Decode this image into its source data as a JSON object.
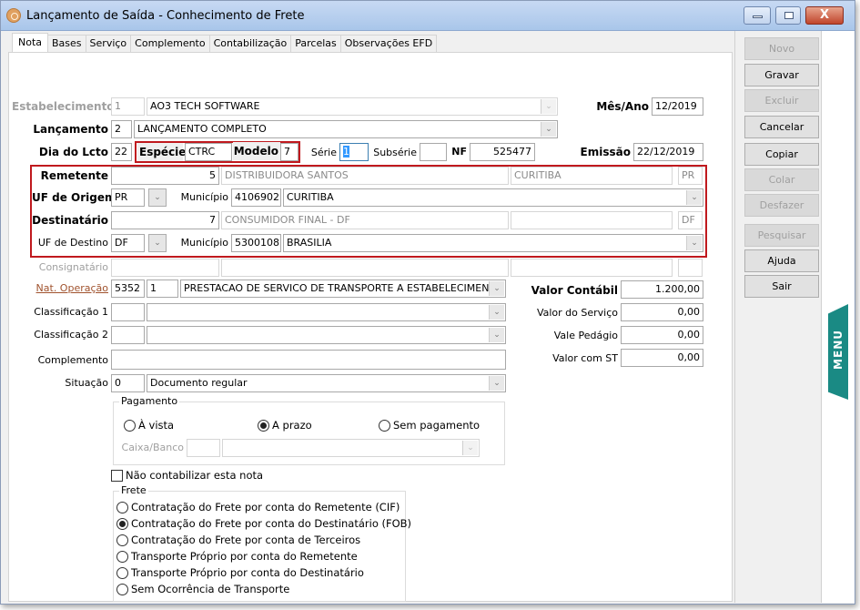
{
  "window": {
    "title": "Lançamento de Saída - Conhecimento de Frete",
    "minimize_label": "",
    "maximize_label": "",
    "close_label": "X"
  },
  "tabs": [
    {
      "label": "Nota",
      "active": true
    },
    {
      "label": "Bases"
    },
    {
      "label": "Serviço"
    },
    {
      "label": "Complemento"
    },
    {
      "label": "Contabilização"
    },
    {
      "label": "Parcelas"
    },
    {
      "label": "Observações EFD"
    }
  ],
  "form": {
    "estabelecimento": {
      "label": "Estabelecimento",
      "code": "1",
      "name": "AO3 TECH SOFTWARE"
    },
    "mes_ano": {
      "label": "Mês/Ano",
      "value": "12/2019"
    },
    "lancamento": {
      "label": "Lançamento",
      "code": "2",
      "name": "LANÇAMENTO COMPLETO"
    },
    "dia_lcto": {
      "label": "Dia do Lcto",
      "value": "22"
    },
    "especie": {
      "label": "Espécie",
      "value": "CTRC"
    },
    "modelo": {
      "label": "Modelo",
      "value": "7"
    },
    "serie": {
      "label": "Série",
      "value": "1"
    },
    "subserie": {
      "label": "Subsérie",
      "value": ""
    },
    "nf": {
      "label": "NF",
      "value": "525477"
    },
    "emissao": {
      "label": "Emissão",
      "value": "22/12/2019"
    },
    "remetente": {
      "label": "Remetente",
      "code": "5",
      "name": "DISTRIBUIDORA SANTOS",
      "city": "CURITIBA",
      "uf": "PR"
    },
    "uf_origem": {
      "label": "UF de Origem",
      "value": "PR",
      "municipio_label": "Município",
      "municipio_code": "4106902",
      "municipio_name": "CURITIBA"
    },
    "destinatario": {
      "label": "Destinatário",
      "code": "7",
      "name": "CONSUMIDOR FINAL - DF",
      "city": "",
      "uf": "DF"
    },
    "uf_destino": {
      "label": "UF de Destino",
      "value": "DF",
      "municipio_label": "Município",
      "municipio_code": "5300108",
      "municipio_name": "BRASILIA"
    },
    "consignatario": {
      "label": "Consignatário",
      "code": "",
      "name": "",
      "city": "",
      "uf": ""
    },
    "nat_operacao": {
      "label": "Nat. Operação",
      "code": "5352",
      "seq": "1",
      "description": "PRESTACAO DE SERVICO DE TRANSPORTE A ESTABELECIMEN"
    },
    "classificacao1": {
      "label": "Classificação 1",
      "code": "",
      "value": ""
    },
    "classificacao2": {
      "label": "Classificação 2",
      "code": "",
      "value": ""
    },
    "complemento": {
      "label": "Complemento",
      "value": ""
    },
    "situacao": {
      "label": "Situação",
      "code": "0",
      "value": "Documento regular"
    },
    "valores": {
      "valor_contabil": {
        "label": "Valor Contábil",
        "value": "1.200,00"
      },
      "valor_servico": {
        "label": "Valor do Serviço",
        "value": "0,00"
      },
      "vale_pedagio": {
        "label": "Vale Pedágio",
        "value": "0,00"
      },
      "valor_st": {
        "label": "Valor com ST",
        "value": "0,00"
      }
    },
    "pagamento": {
      "legend": "Pagamento",
      "options": [
        {
          "label": "À vista",
          "selected": false
        },
        {
          "label": "A prazo",
          "selected": true
        },
        {
          "label": "Sem pagamento",
          "selected": false
        }
      ],
      "caixa_banco": {
        "label": "Caixa/Banco",
        "code": "",
        "value": ""
      }
    },
    "nao_contabilizar": {
      "label": "Não contabilizar esta nota",
      "checked": false
    },
    "frete": {
      "legend": "Frete",
      "options": [
        {
          "label": "Contratação do Frete por conta do Remetente (CIF)",
          "selected": false
        },
        {
          "label": "Contratação do Frete por conta do Destinatário (FOB)",
          "selected": true
        },
        {
          "label": "Contratação do Frete por conta de Terceiros",
          "selected": false
        },
        {
          "label": "Transporte Próprio por conta do Remetente",
          "selected": false
        },
        {
          "label": "Transporte Próprio por conta do Destinatário",
          "selected": false
        },
        {
          "label": "Sem Ocorrência de Transporte",
          "selected": false
        }
      ]
    }
  },
  "sidebar": {
    "buttons": [
      {
        "label": "Novo",
        "mnemonic": "N",
        "enabled": false
      },
      {
        "label": "Gravar",
        "mnemonic": "G",
        "enabled": true
      },
      {
        "label": "Excluir",
        "mnemonic": "E",
        "enabled": false
      },
      {
        "label": "Cancelar",
        "mnemonic": "C",
        "enabled": true
      },
      {
        "label": "Copiar",
        "mnemonic": "p",
        "enabled": true
      },
      {
        "label": "Colar",
        "mnemonic": "l",
        "enabled": false
      },
      {
        "label": "Desfazer",
        "mnemonic": "f",
        "enabled": false
      },
      {
        "label": "Pesquisar",
        "mnemonic": "P",
        "enabled": false
      },
      {
        "label": "Ajuda",
        "mnemonic": "A",
        "enabled": true
      },
      {
        "label": "Sair",
        "mnemonic": "S",
        "enabled": true
      }
    ]
  },
  "menu_tab": {
    "label": "MENU"
  },
  "colors": {
    "highlight_border": "#c0191e",
    "menu_tab": "#1a8a84",
    "link": "#a0522d",
    "titlebar": "#a9c6ea"
  }
}
